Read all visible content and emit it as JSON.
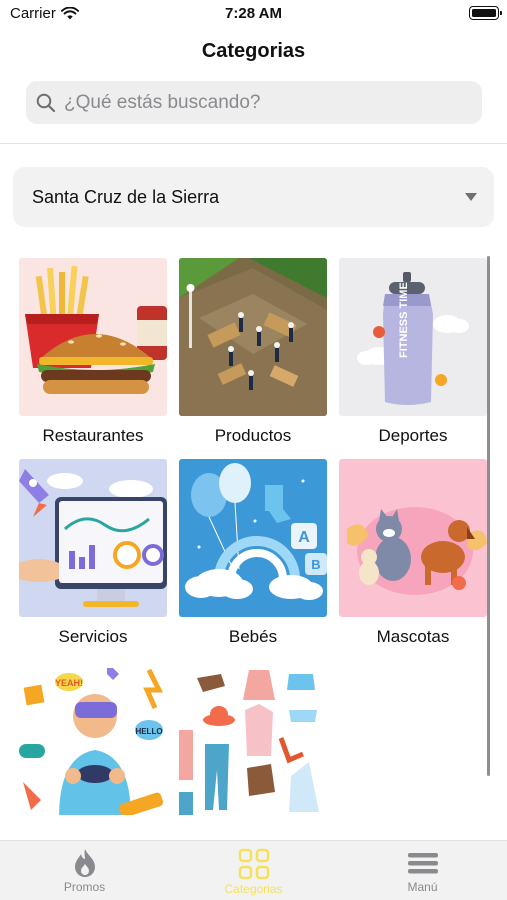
{
  "status": {
    "carrier": "Carrier",
    "time": "7:28 AM"
  },
  "header": {
    "title": "Categorias"
  },
  "search": {
    "placeholder": "¿Qué estás buscando?"
  },
  "city": {
    "selected": "Santa Cruz de la Sierra"
  },
  "categories": [
    {
      "label": "Restaurantes"
    },
    {
      "label": "Productos"
    },
    {
      "label": "Deportes"
    },
    {
      "label": "Servicios"
    },
    {
      "label": "Bebés"
    },
    {
      "label": "Mascotas"
    },
    {
      "label": ""
    },
    {
      "label": ""
    }
  ],
  "tabs": [
    {
      "label": "Promos",
      "icon": "flame-icon",
      "active": false
    },
    {
      "label": "Categorias",
      "icon": "grid-icon",
      "active": true
    },
    {
      "label": "Manú",
      "icon": "menu-icon",
      "active": false
    }
  ],
  "colors": {
    "active_tab": "#f6e05a",
    "inactive_tab": "#8a8a8e"
  }
}
